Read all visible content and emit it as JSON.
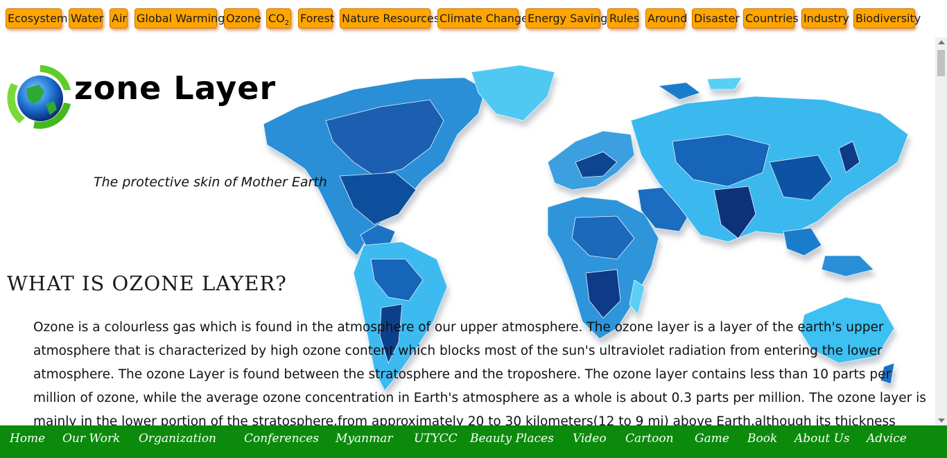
{
  "top_nav": [
    {
      "label": "Ecosystem"
    },
    {
      "label": "Water"
    },
    {
      "label": "Air"
    },
    {
      "label": "Global Warming"
    },
    {
      "label": "Ozone"
    },
    {
      "label": "CO",
      "sub": "2"
    },
    {
      "label": "Forest"
    },
    {
      "label": "Nature Resources"
    },
    {
      "label": "Climate Change"
    },
    {
      "label": "Energy Saving"
    },
    {
      "label": "Rules"
    },
    {
      "label": "Around"
    },
    {
      "label": "Disaster"
    },
    {
      "label": "Countries"
    },
    {
      "label": "Industry"
    },
    {
      "label": "Biodiversity"
    }
  ],
  "header": {
    "title": "zone Layer",
    "tagline": "The protective skin of Mother Earth",
    "logo_icon": "recycling-globe-icon",
    "background_image": "world-map"
  },
  "main": {
    "section_heading": "What is Ozone Layer?",
    "body": "Ozone is a colourless gas which is found in the atmosphere of our upper atmosphere. The ozone layer is a layer of the earth's upper atmosphere that is characterized by high ozone content which blocks most of the sun's ultraviolet radiation from entering the lower atmosphere. The ozone Layer is found between the stratosphere and the troposhere. The ozone layer contains less than 10 parts per million of ozone, while the average ozone concentration in Earth's atmosphere as a whole is about 0.3 parts per million. The ozone layer is mainly in the lower portion of the stratosphere,from approximately 20 to 30 kilometers(12 to 9 mi) above Earth,although its thickness varies seasinally and geographically. The"
  },
  "bottom_nav": [
    {
      "label": "Home"
    },
    {
      "label": "Our Work"
    },
    {
      "label": "Organization"
    },
    {
      "label": "Conferences"
    },
    {
      "label": "Myanmar"
    },
    {
      "label": "UTYCC"
    },
    {
      "label": "Beauty Places"
    },
    {
      "label": "Video"
    },
    {
      "label": "Cartoon"
    },
    {
      "label": "Game"
    },
    {
      "label": "Book"
    },
    {
      "label": "About Us"
    },
    {
      "label": "Advice"
    }
  ],
  "colors": {
    "nav_button": "#ffa500",
    "bottom_bar": "#0c8a0c",
    "map_light": "#3fc3f0",
    "map_dark": "#0a3d8a"
  }
}
